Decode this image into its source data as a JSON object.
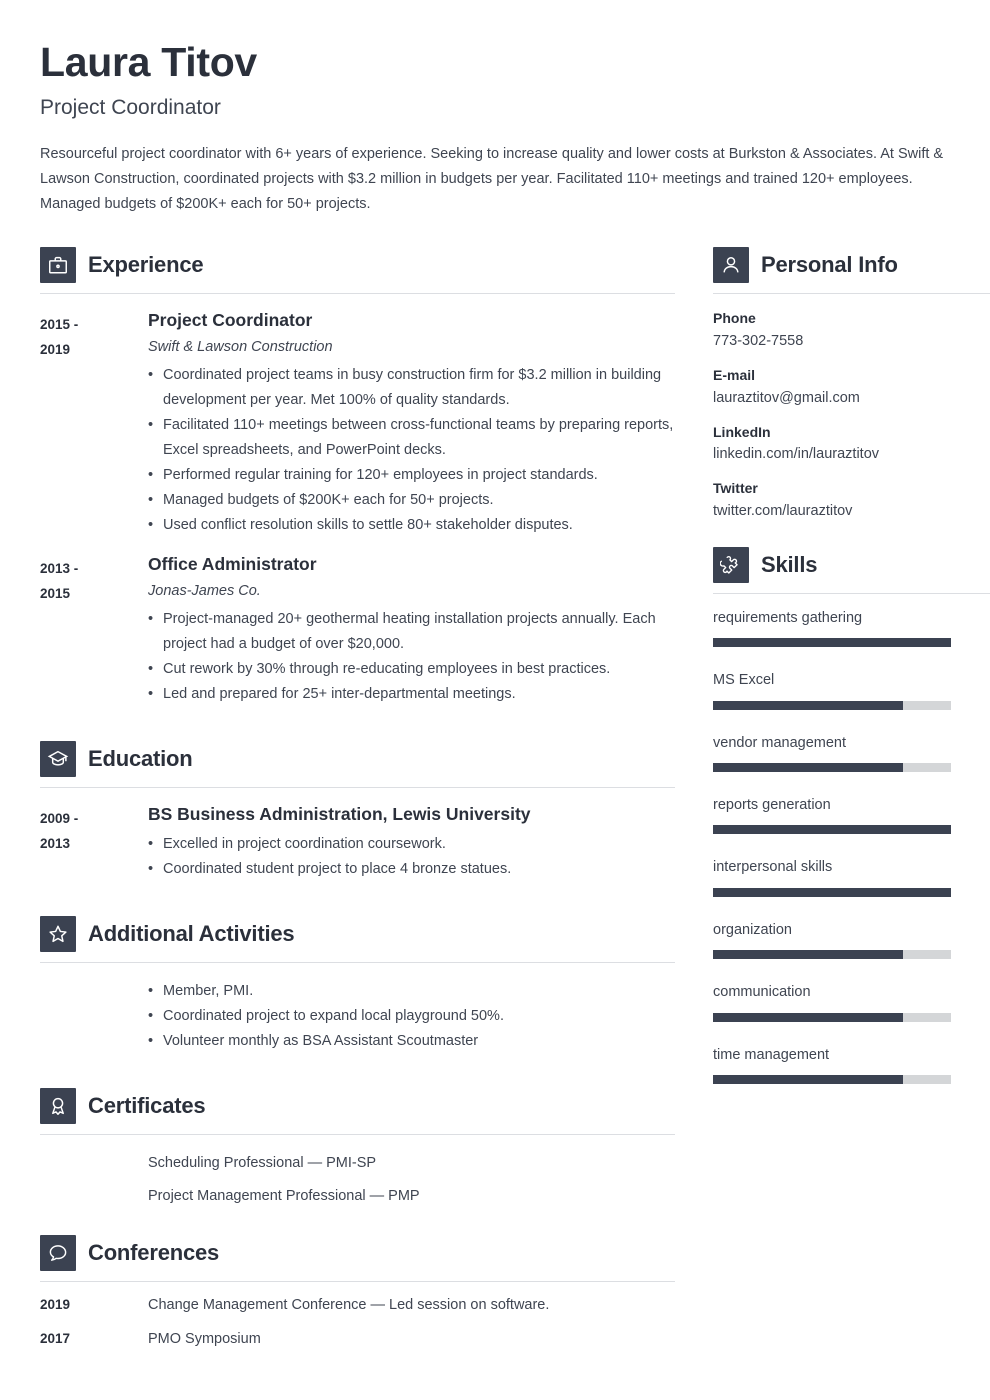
{
  "header": {
    "name": "Laura Titov",
    "job_title": "Project Coordinator",
    "summary": "Resourceful project coordinator with 6+ years of experience. Seeking to increase quality and lower costs at Burkston & Associates. At Swift & Lawson Construction, coordinated projects with $3.2 million in budgets per year. Facilitated 110+ meetings and trained 120+ employees. Managed budgets of $200K+ each for 50+ projects."
  },
  "sections": {
    "experience": {
      "title": "Experience",
      "icon": "briefcase-icon",
      "entries": [
        {
          "date_start": "2015 -",
          "date_end": "2019",
          "role": "Project Coordinator",
          "org": "Swift & Lawson Construction",
          "bullets": [
            "Coordinated project teams in busy construction firm for $3.2 million in building development per year. Met 100% of quality standards.",
            "Facilitated 110+ meetings between cross-functional teams by preparing reports, Excel spreadsheets, and PowerPoint decks.",
            "Performed regular training for 120+ employees in project standards.",
            "Managed budgets of $200K+ each for 50+ projects.",
            "Used conflict resolution skills to settle 80+ stakeholder disputes."
          ]
        },
        {
          "date_start": "2013 -",
          "date_end": "2015",
          "role": "Office Administrator",
          "org": "Jonas-James Co.",
          "bullets": [
            "Project-managed 20+ geothermal heating installation projects annually. Each project had a budget of over $20,000.",
            "Cut rework by 30% through re-educating employees in best practices.",
            "Led and prepared for 25+ inter-departmental meetings."
          ]
        }
      ]
    },
    "education": {
      "title": "Education",
      "icon": "graduation-cap-icon",
      "entries": [
        {
          "date_start": "2009 -",
          "date_end": "2013",
          "role": "BS Business Administration, Lewis University",
          "bullets": [
            "Excelled in project coordination coursework.",
            "Coordinated student project to place 4 bronze statues."
          ]
        }
      ]
    },
    "activities": {
      "title": "Additional Activities",
      "icon": "star-icon",
      "bullets": [
        "Member, PMI.",
        "Coordinated project to expand local playground 50%.",
        "Volunteer monthly as BSA Assistant Scoutmaster"
      ]
    },
    "certificates": {
      "title": "Certificates",
      "icon": "award-ribbon-icon",
      "items": [
        "Scheduling Professional — PMI-SP",
        "Project Management Professional — PMP"
      ]
    },
    "conferences": {
      "title": "Conferences",
      "icon": "speech-bubble-icon",
      "items": [
        {
          "year": "2019",
          "text": "Change Management Conference — Led session on software."
        },
        {
          "year": "2017",
          "text": "PMO Symposium"
        }
      ]
    },
    "personal_info": {
      "title": "Personal Info",
      "icon": "person-icon",
      "fields": [
        {
          "label": "Phone",
          "value": "773-302-7558"
        },
        {
          "label": "E-mail",
          "value": "lauraztitov@gmail.com"
        },
        {
          "label": "LinkedIn",
          "value": "linkedin.com/in/lauraztitov"
        },
        {
          "label": "Twitter",
          "value": "twitter.com/lauraztitov"
        }
      ]
    },
    "skills": {
      "title": "Skills",
      "icon": "puzzle-piece-icon",
      "items": [
        {
          "name": "requirements gathering",
          "level": 100
        },
        {
          "name": "MS Excel",
          "level": 80
        },
        {
          "name": "vendor management",
          "level": 80
        },
        {
          "name": "reports generation",
          "level": 100
        },
        {
          "name": "interpersonal skills",
          "level": 100
        },
        {
          "name": "organization",
          "level": 80
        },
        {
          "name": "communication",
          "level": 80
        },
        {
          "name": "time management",
          "level": 80
        }
      ]
    }
  },
  "colors": {
    "accent_dark": "#3b4251",
    "heading": "#2b303b",
    "body_text": "#3f4551",
    "rule": "#dcdee2",
    "skill_track": "#d4d6d8"
  }
}
